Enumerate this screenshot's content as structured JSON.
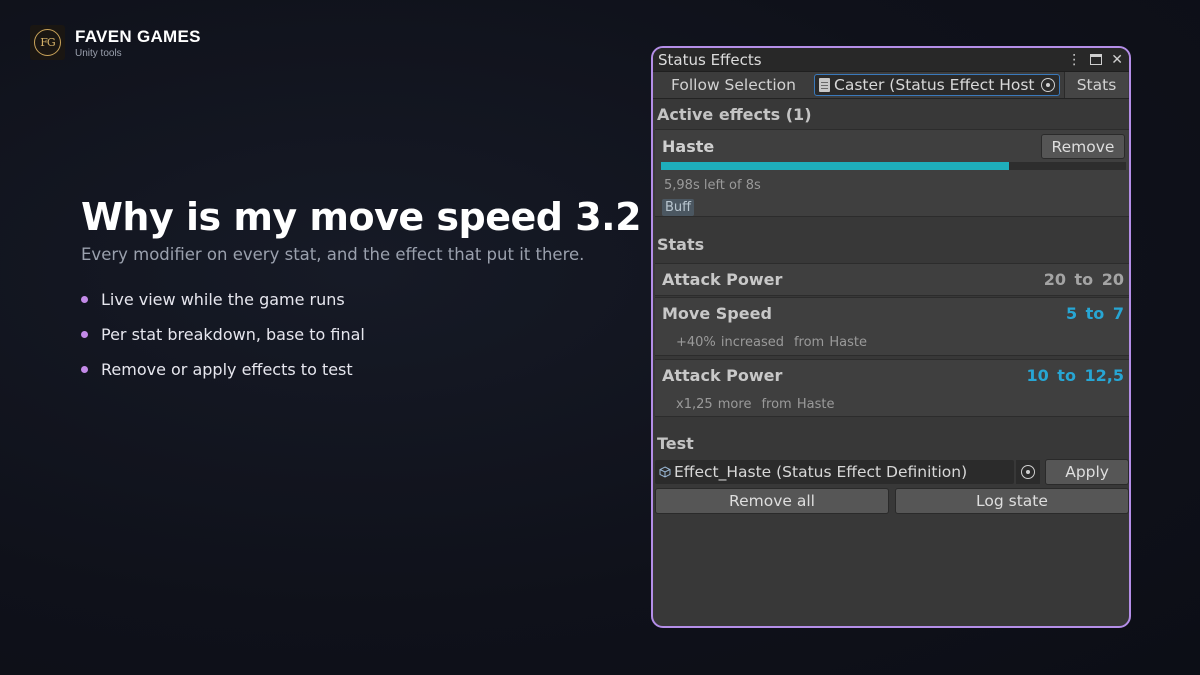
{
  "brand": {
    "name": "FAVEN GAMES",
    "tagline": "Unity tools",
    "logo_text": "FG"
  },
  "hero": {
    "title": "Why is my move speed 3.2",
    "subtitle": "Every modifier on every stat, and the effect that put it there.",
    "bullets": [
      "Live view while the game runs",
      "Per stat breakdown, base to final",
      "Remove or apply effects to test"
    ]
  },
  "window": {
    "title": "Status Effects",
    "toolbar": {
      "follow_label": "Follow Selection",
      "target_field": "Caster (Status Effect Host",
      "stats_tab": "Stats"
    },
    "active_effects": {
      "header": "Active effects (1)",
      "effect": {
        "name": "Haste",
        "remove_label": "Remove",
        "progress": 0.7475,
        "time_text": "5,98s left of 8s",
        "tag": "Buff"
      }
    },
    "stats": {
      "header": "Stats",
      "rows": [
        {
          "name": "Attack Power",
          "value": "20 to 20",
          "changed": false,
          "modifier": "",
          "source": ""
        },
        {
          "name": "Move Speed",
          "value": "5 to 7",
          "changed": true,
          "modifier": "+40% increased",
          "source": "from Haste"
        },
        {
          "name": "Attack Power",
          "value": "10 to 12,5",
          "changed": true,
          "modifier": "x1,25 more",
          "source": "from Haste"
        }
      ]
    },
    "test": {
      "header": "Test",
      "definition_field": "Effect_Haste (Status Effect Definition)",
      "apply_label": "Apply",
      "remove_all_label": "Remove all",
      "log_state_label": "Log state"
    }
  },
  "colors": {
    "accent": "#b48ee8",
    "bullet": "#c38ae8",
    "progress": "#1eaebb",
    "changed_value": "#27a6d4"
  }
}
